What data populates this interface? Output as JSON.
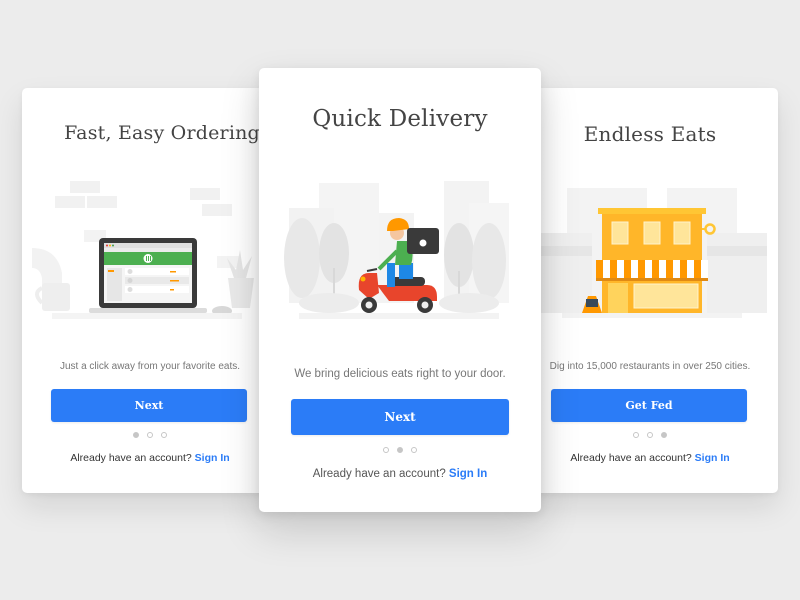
{
  "colors": {
    "background": "#ececec",
    "card": "#ffffff",
    "primary_button": "#2b7cf7",
    "link": "#2b7cf7",
    "title_text": "#444444",
    "body_text": "#777777",
    "dot_inactive": "#c6c6c6",
    "illustration_green": "#4caf50",
    "illustration_orange": "#ff9800",
    "illustration_yellow": "#ffc634",
    "scooter_red": "#e8452c"
  },
  "cards": [
    {
      "title": "Fast, Easy Ordering",
      "illustration": "laptop-on-desk-illustration",
      "description": "Just a click away from your favorite eats.",
      "button_label": "Next",
      "page_indicator": {
        "current": 1,
        "total": 3
      },
      "signin_prompt": "Already have an account?",
      "signin_link": "Sign In"
    },
    {
      "title": "Quick Delivery",
      "illustration": "scooter-delivery-illustration",
      "description": "We bring delicious eats right to your door.",
      "button_label": "Next",
      "page_indicator": {
        "current": 2,
        "total": 3
      },
      "signin_prompt": "Already have an account?",
      "signin_link": "Sign In"
    },
    {
      "title": "Endless Eats",
      "illustration": "storefront-illustration",
      "description": "Dig into 15,000 restaurants in over 250 cities.",
      "button_label": "Get Fed",
      "page_indicator": {
        "current": 3,
        "total": 3
      },
      "signin_prompt": "Already have an account?",
      "signin_link": "Sign In"
    }
  ]
}
